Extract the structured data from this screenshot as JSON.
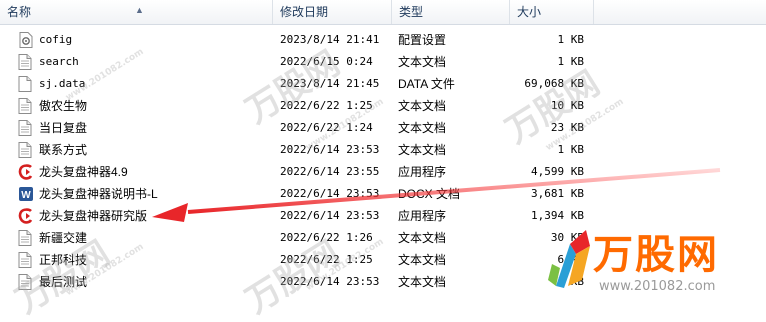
{
  "columns": {
    "name": "名称",
    "date": "修改日期",
    "type": "类型",
    "size": "大小"
  },
  "files": [
    {
      "name": "cofig",
      "date": "2023/8/14 21:41",
      "type": "配置设置",
      "size": "1 KB",
      "icon": "config-file-icon"
    },
    {
      "name": "search",
      "date": "2022/6/15 0:24",
      "type": "文本文档",
      "size": "1 KB",
      "icon": "text-file-icon"
    },
    {
      "name": "sj.data",
      "date": "2023/8/14 21:45",
      "type": "DATA 文件",
      "size": "69,068 KB",
      "icon": "data-file-icon"
    },
    {
      "name": "傲农生物",
      "date": "2022/6/22 1:25",
      "type": "文本文档",
      "size": "10 KB",
      "icon": "text-file-icon"
    },
    {
      "name": "当日复盘",
      "date": "2022/6/22 1:24",
      "type": "文本文档",
      "size": "23 KB",
      "icon": "text-file-icon"
    },
    {
      "name": "联系方式",
      "date": "2022/6/14 23:53",
      "type": "文本文档",
      "size": "1 KB",
      "icon": "text-file-icon"
    },
    {
      "name": "龙头复盘神器4.9",
      "date": "2022/6/14 23:55",
      "type": "应用程序",
      "size": "4,599 KB",
      "icon": "app-icon"
    },
    {
      "name": "龙头复盘神器说明书-L",
      "date": "2022/6/14 23:53",
      "type": "DOCX 文档",
      "size": "3,681 KB",
      "icon": "word-doc-icon"
    },
    {
      "name": "龙头复盘神器研究版",
      "date": "2022/6/14 23:53",
      "type": "应用程序",
      "size": "1,394 KB",
      "icon": "app-icon"
    },
    {
      "name": "新疆交建",
      "date": "2022/6/22 1:26",
      "type": "文本文档",
      "size": "30 KB",
      "icon": "text-file-icon"
    },
    {
      "name": "正邦科技",
      "date": "2022/6/22 1:25",
      "type": "文本文档",
      "size": "6 KB",
      "icon": "text-file-icon"
    },
    {
      "name": "最后测试",
      "date": "2022/6/14 23:53",
      "type": "文本文档",
      "size": "1 KB",
      "icon": "text-file-icon"
    }
  ],
  "watermark": {
    "brand": "万股网",
    "url": "www.201082.com"
  },
  "colors": {
    "header_text": "#1e395b",
    "arrow": "#e8262a",
    "logo_orange": "#ff6a00",
    "app_icon_red": "#d42020",
    "word_blue": "#2b5797"
  }
}
